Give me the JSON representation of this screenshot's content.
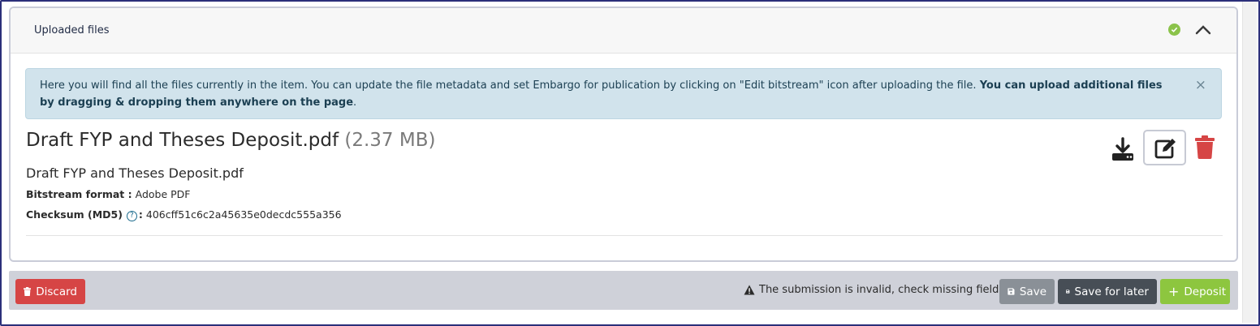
{
  "card": {
    "title": "Uploaded files"
  },
  "alert": {
    "text_before": "Here you will find all the files currently in the item. You can update the file metadata and set Embargo for publication by clicking on \"Edit bitstream\" icon after uploading the file. ",
    "text_bold": "You can upload additional files by dragging & dropping them anywhere on the page",
    "text_after": ".",
    "close_glyph": "×"
  },
  "file": {
    "name": "Draft FYP and Theses Deposit.pdf",
    "size": "(2.37 MB)",
    "subtitle": "Draft FYP and Theses Deposit.pdf",
    "format_label": "Bitstream format :",
    "format_value": "Adobe PDF",
    "checksum_label": "Checksum (MD5)",
    "checksum_sep": ":",
    "checksum_value": "406cff51c6c2a45635e0decdc555a356",
    "help_glyph": "?"
  },
  "icons": {
    "status": "check-circle-icon",
    "collapse": "chevron-up-icon",
    "download": "download-icon",
    "edit": "edit-icon",
    "delete": "trash-icon"
  },
  "colors": {
    "success": "#8bc34a",
    "danger": "#d64545",
    "alert_bg": "#d1e3ec",
    "dark_button": "#474e56",
    "secondary_button": "#8a9097"
  },
  "footer": {
    "discard_label": "Discard",
    "invalid_message": "The submission is invalid, check missing fields",
    "save_label": "Save",
    "save_later_label": "Save for later",
    "deposit_label": "Deposit",
    "deposit_prefix": "+"
  }
}
